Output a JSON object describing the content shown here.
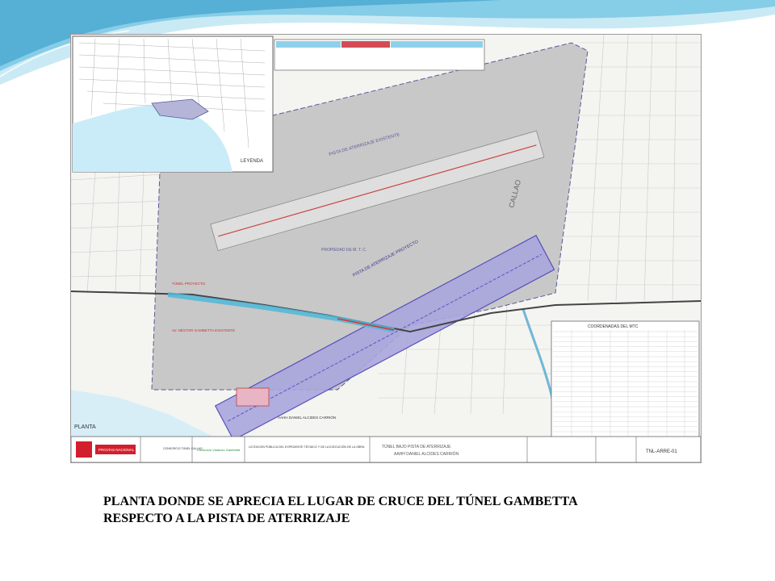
{
  "theme": {
    "swoosh_dark": "#4aa8cf",
    "swoosh_light": "#bfe6f2",
    "runway_fill": "#a9a6de",
    "runway_stroke": "#4a42b8",
    "airport_fill": "#c8c8c8",
    "map_inset_water": "#c9ecf8"
  },
  "plan": {
    "inset_legend": "LEYENDA",
    "labels": {
      "callao": "CALLAO",
      "existing_runway": "PISTA DE ATERRIZAJE EXISTENTE",
      "new_runway": "PISTA DE ATERRIZAJE PROYECTO",
      "property": "PROPIEDAD DE M. T. C.",
      "tunnel_1": "TÚNEL PROYECTO",
      "tunnel_2": "AV. NÉSTOR GAMBETTA EXISTENTE",
      "coords_title": "COORDENADAS DEL MTC",
      "aahh": "AAHH DANIEL ALCIDES CARRIÓN",
      "plan_label": "PLANTA"
    },
    "title_block": {
      "client": "PROVÍAS NACIONAL",
      "consortium": "CONSORCIO TÚNEL CALLAO",
      "supervisor": "Consorcio Viaducto Gambetta",
      "work_text": "LICITACIÓN PÚBLICA DEL EXPEDIENTE TÉCNICO Y DE LA EJECUCIÓN DE LA OBRA",
      "sheet_title": "TÚNEL BAJO PISTA DE ATERRIZAJE",
      "sheet_subtitle": "AAHH DANIEL ALCIDES CARRIÓN",
      "sheet_code": "TNL-ARRE-01"
    }
  },
  "caption": {
    "line1": "PLANTA DONDE SE APRECIA EL LUGAR DE CRUCE DEL TÚNEL GAMBETTA",
    "line2": "RESPECTO A LA PISTA DE ATERRIZAJE"
  }
}
